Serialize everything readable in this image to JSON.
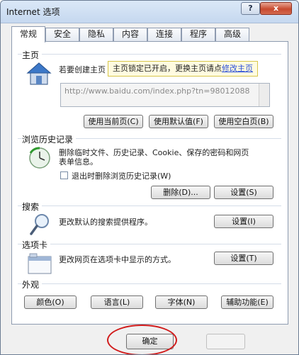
{
  "window": {
    "title": "Internet 选项",
    "help": "?",
    "close": "x"
  },
  "tabs": [
    {
      "label": "常规",
      "active": true
    },
    {
      "label": "安全"
    },
    {
      "label": "隐私"
    },
    {
      "label": "内容"
    },
    {
      "label": "连接"
    },
    {
      "label": "程序"
    },
    {
      "label": "高级"
    }
  ],
  "homepage": {
    "title": "主页",
    "desc": "若要创建主页",
    "tooltip_text": "主页锁定已开启，更换主页请点",
    "tooltip_link": "修改主页",
    "url": "http://www.baidu.com/index.php?tn=98012088",
    "btn_current": "使用当前页(C)",
    "btn_default": "使用默认值(F)",
    "btn_blank": "使用空白页(B)"
  },
  "history": {
    "title": "浏览历史记录",
    "desc_line1": "删除临时文件、历史记录、Cookie、保存的密码和网页",
    "desc_line2": "表单信息。",
    "checkbox_label": "退出时删除浏览历史记录(W)",
    "btn_delete": "删除(D)...",
    "btn_settings": "设置(S)"
  },
  "search": {
    "title": "搜索",
    "desc": "更改默认的搜索提供程序。",
    "btn_settings": "设置(I)"
  },
  "tabs_section": {
    "title": "选项卡",
    "desc": "更改网页在选项卡中显示的方式。",
    "btn_settings": "设置(T)"
  },
  "appearance": {
    "title": "外观",
    "btn_colors": "颜色(O)",
    "btn_languages": "语言(L)",
    "btn_fonts": "字体(N)",
    "btn_accessibility": "辅助功能(E)"
  },
  "footer": {
    "ok": "确定"
  }
}
